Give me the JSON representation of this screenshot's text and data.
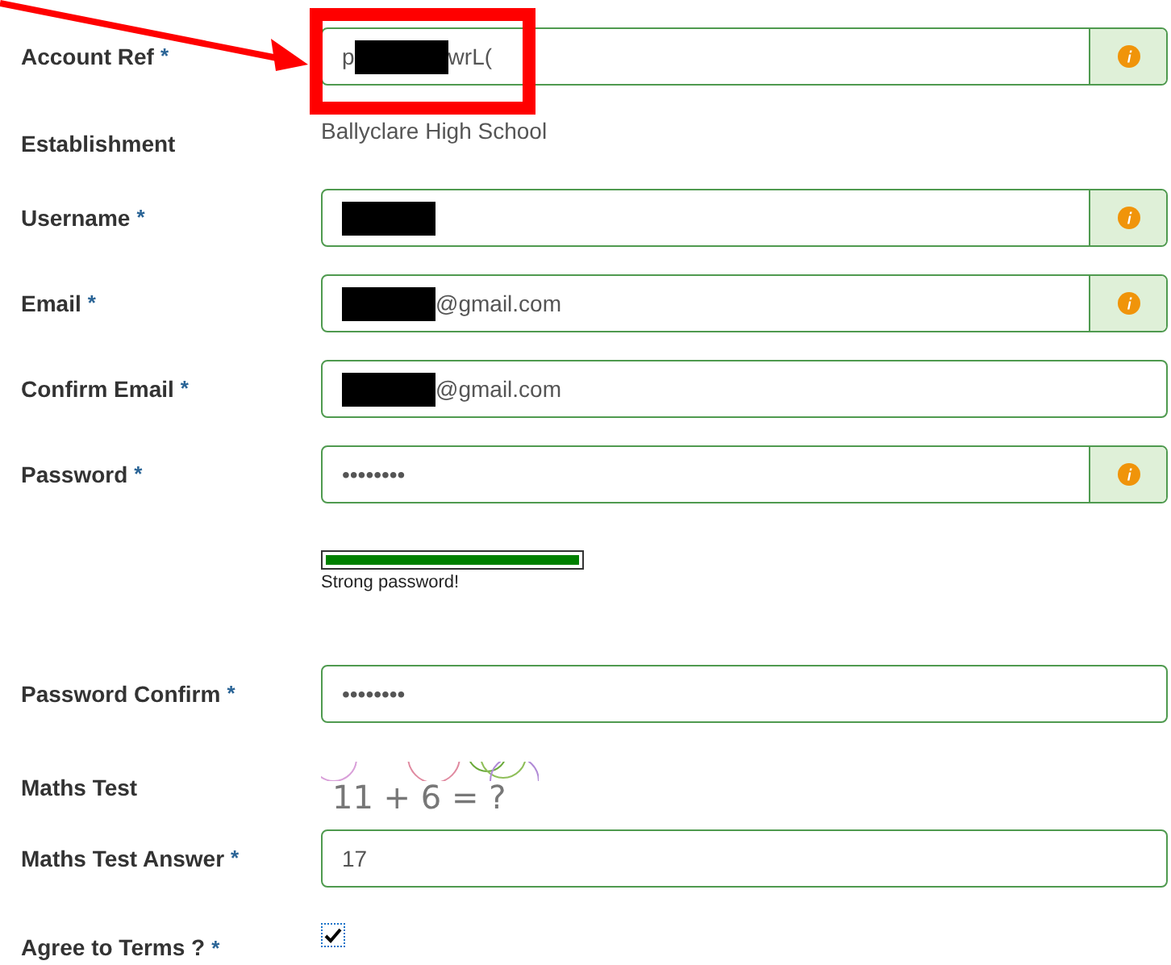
{
  "fields": [
    {
      "kind": "input",
      "label": "Account Ref",
      "required_mark": "*",
      "info": true,
      "segments": [
        {
          "kind": "text",
          "text": "p"
        },
        {
          "kind": "redaction"
        },
        {
          "kind": "text",
          "text": "wrL("
        }
      ]
    },
    {
      "kind": "static",
      "label": "Establishment",
      "value": "Ballyclare High School"
    },
    {
      "kind": "input",
      "label": "Username",
      "required_mark": "*",
      "info": true,
      "segments": [
        {
          "kind": "redaction"
        }
      ]
    },
    {
      "kind": "input",
      "label": "Email",
      "required_mark": "*",
      "info": true,
      "segments": [
        {
          "kind": "redaction"
        },
        {
          "kind": "text",
          "text": "@gmail.com"
        }
      ]
    },
    {
      "kind": "input",
      "label": "Confirm Email",
      "required_mark": "*",
      "segments": [
        {
          "kind": "redaction"
        },
        {
          "kind": "text",
          "text": "@gmail.com"
        }
      ]
    },
    {
      "kind": "input",
      "label": "Password",
      "required_mark": "*",
      "info": true,
      "segments": [
        {
          "kind": "text",
          "text": "••••••••"
        }
      ]
    },
    {
      "kind": "strength",
      "level": 1,
      "text": "Strong password!"
    },
    {
      "kind": "input",
      "label": "Password Confirm",
      "required_mark": "*",
      "segments": [
        {
          "kind": "text",
          "text": "••••••••"
        }
      ]
    },
    {
      "kind": "captcha",
      "label": "Maths Test",
      "question": "11 + 6 = ?"
    },
    {
      "kind": "input",
      "label": "Maths Test Answer",
      "required_mark": "*",
      "segments": [
        {
          "kind": "text",
          "text": "17"
        }
      ]
    },
    {
      "kind": "checkbox",
      "label": "Agree to Terms ?",
      "required_mark": "*",
      "checked": true
    }
  ]
}
